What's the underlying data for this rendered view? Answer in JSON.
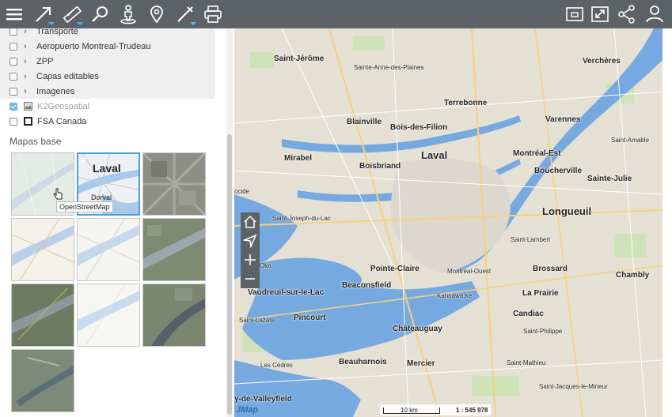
{
  "toolbar": {
    "buttons": [
      "menu-icon",
      "select-tool-icon",
      "measure-icon",
      "search-location-icon",
      "streetview-icon",
      "marker-icon",
      "draw-icon",
      "print-icon",
      "panel-icon",
      "fullscreen-icon",
      "share-icon",
      "user-icon"
    ]
  },
  "layers": [
    {
      "label": "Transporte",
      "checked": false,
      "expandable": true
    },
    {
      "label": "Aeropuerto Montreal-Trudeau",
      "checked": false,
      "expandable": true
    },
    {
      "label": "ZPP",
      "checked": false,
      "expandable": true
    },
    {
      "label": "Capas editables",
      "checked": false,
      "expandable": true
    },
    {
      "label": "Imagenes",
      "checked": false,
      "expandable": true
    },
    {
      "label": "K2Geospatial",
      "checked": true,
      "expandable": false
    },
    {
      "label": "FSA Canada",
      "checked": false,
      "expandable": false
    }
  ],
  "basemaps": {
    "title": "Mapas base",
    "selected_labels": {
      "big": "Laval",
      "small": "Dorval"
    },
    "tooltip": "OpenStreetMap"
  },
  "map": {
    "places": {
      "saint_jerome": "Saint-Jérôme",
      "sainte_anne": "Sainte-Anne-des-Plaines",
      "vercheres": "Verchères",
      "terrebonne": "Terrebonne",
      "blainville": "Blainville",
      "bois_des_filion": "Bois-des-Filion",
      "varennes": "Varennes",
      "laval": "Laval",
      "mirabel": "Mirabel",
      "montreal_est": "Montréal-Est",
      "saint_amable": "Saint-Amable",
      "boisbriand": "Boisbriand",
      "boucherville": "Boucherville",
      "sainte_julie": "Sainte-Julie",
      "ocide": "ocide",
      "longueuil": "Longueuil",
      "saint_joseph": "Saint-Joseph-du-Lac",
      "saint_lambert": "Saint-Lambert",
      "oka": "Oka",
      "pointe_claire": "Pointe-Claire",
      "montreal_ouest": "Montréal-Ouest",
      "brossard": "Brossard",
      "chambly": "Chambly",
      "beaconsfield": "Beaconsfield",
      "vaudreuil": "Vaudreuil-sur-le-Lac",
      "kahnawake": "Kahnawà:ke",
      "la_prairie": "La Prairie",
      "candiac": "Candiac",
      "saint_lazare": "Saint-Lazare",
      "pincourt": "Pincourt",
      "saint_philippe": "Saint-Philippe",
      "chateauguay": "Châteauguay",
      "beauharnois": "Beauharnois",
      "mercier": "Mercier",
      "les_cedres": "Les Cèdres",
      "saint_mathieu": "Saint-Mathieu",
      "saint_jacques": "Saint-Jacques-le-Mineur",
      "valleyfield": "y-de-Valleyfield"
    },
    "scale_distance": "10 km",
    "scale_ratio": "1 : 545 978",
    "logo": "JMap"
  }
}
